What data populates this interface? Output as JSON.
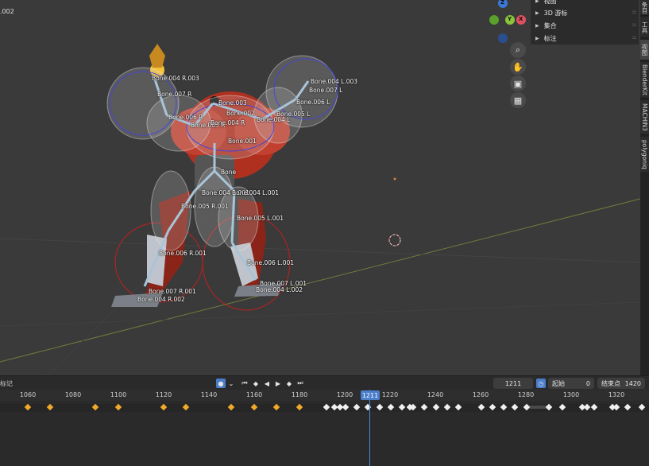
{
  "viewport": {
    "object_name": ".002",
    "bone_labels": [
      "Bone.004 R.003",
      "Bone.007 R",
      "Bone.006 R",
      "Bone.005 R",
      "Bone.004 R",
      "Bone.003",
      "Bone.002",
      "Bone.001",
      "Bone",
      "Bone.004 L.003",
      "Bone.007 L",
      "Bone.006 L",
      "Bone.005 L",
      "Bone.004 L",
      "Bone.004 R.001",
      "Bone.004 L.001",
      "Bone.005 R.001",
      "Bone.005 L.001",
      "Bone.006 R.001",
      "Bone.006 L.001",
      "Bone.007 R.001",
      "Bone.004 R.002",
      "Bone.007 L.001",
      "Bone.004 L.002"
    ]
  },
  "gizmo": {
    "z": "Z",
    "y": "Y",
    "x": "X"
  },
  "nav_icons": [
    "zoom-icon",
    "hand-pan-icon",
    "camera-icon",
    "grid-view-icon"
  ],
  "npanel": {
    "items": [
      {
        "label": "视图"
      },
      {
        "label": "3D 游标"
      },
      {
        "label": "集合"
      },
      {
        "label": "标注"
      }
    ]
  },
  "sidebar_tabs": [
    "条目",
    "工具",
    "视图",
    "BlenderKit",
    "MACHIN3",
    "polygoniq"
  ],
  "timeline": {
    "left_label": "标记",
    "current_frame": "1211",
    "start_label": "起始",
    "start_value": "0",
    "end_label": "结束点",
    "end_value": "1420",
    "ticks": [
      "1060",
      "1080",
      "1100",
      "1120",
      "1140",
      "1160",
      "1180",
      "1200",
      "1220",
      "1240",
      "1260",
      "1280",
      "1300",
      "1320"
    ],
    "playhead_frame": "1211",
    "colors": {
      "selected_key": "#f0a92a",
      "unselected_key": "#f0f0f0",
      "playhead": "#4a7ecb"
    }
  }
}
